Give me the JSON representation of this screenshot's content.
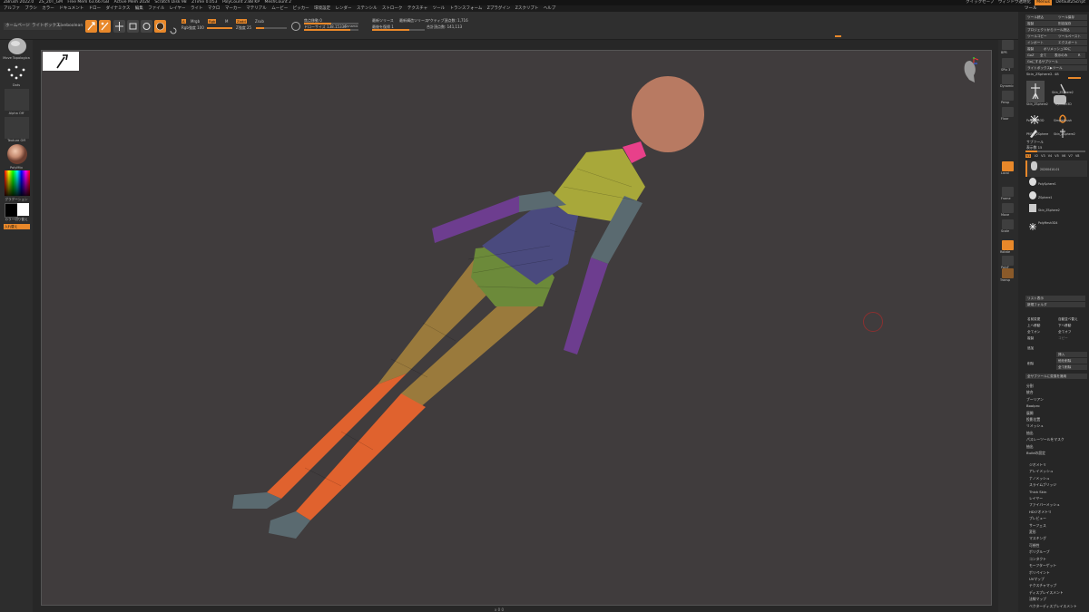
{
  "titlebar": {
    "segments": [
      "ZBrush 2022.0",
      "ZS_20T_GM",
      "Free Mem 63.667GB",
      "Active Mem 2028",
      "Scratch Disk 98",
      "ZTime 0.053",
      "PolyCount 2.88 KP",
      "MeshCount 2"
    ],
    "right_items": [
      "クイックセーブ",
      "ウィンドウ透明化",
      "Menus",
      "DefaultZScript"
    ]
  },
  "menubar": {
    "items": [
      "アルファ",
      "ブラシ",
      "カラー",
      "ドキュメント",
      "ドロー",
      "ダイナミクス",
      "編集",
      "ファイル",
      "レイヤー",
      "ライト",
      "マクロ",
      "マーカー",
      "マテリアル",
      "ムービー",
      "ピッカー",
      "環境設定",
      "レンダー",
      "ステンシル",
      "ストローク",
      "テクスチャ",
      "ツール",
      "トランスフォーム",
      "Zプラグイン",
      "Zスクリプト",
      "ヘルプ"
    ],
    "tool_title": "ツール"
  },
  "shelf": {
    "tabs": [
      "ホームページ",
      "ライトボックス",
      "Liveboolean"
    ],
    "buttons": [
      "edit",
      "draw",
      "move",
      "scale",
      "rotate"
    ],
    "mrgb": "Mrgb",
    "rgb": "Rgb",
    "m": "M",
    "zadd": "Zadd",
    "zsub": "Zsub",
    "rgb_intensity_label": "Rgb強度 100",
    "rgb_intensity": 1.0,
    "z_intensity_label": "Z強度 25",
    "z_intensity": 0.25,
    "focal_shift_label": "焦点移動 0",
    "focal_shift": 0.5,
    "draw_size_label": "ドローサイズ 138.15336",
    "draw_size": 0.85,
    "dynamic": "Dynamic",
    "active_points": "アクティブ頂点数: 1,716",
    "total_points": "合計頂点数: 141,113",
    "symmetry1": "最新ツリース",
    "symmetry2": "最新構造ツリース",
    "history_label": "最後を復帰 1"
  },
  "leftshelf": {
    "brush_name": "Move Topologica",
    "stroke_name": "Dots",
    "alpha_name": "Alpha Off",
    "texture_name": "Texture Off",
    "material_name": "PolyMtx",
    "gradient_label": "グラデーション",
    "switch_color_label": "カラー切り替え",
    "alternate_label": "入れ替え"
  },
  "canvas": {
    "colors": {
      "bg": "#403c3d",
      "head": "#b87a62",
      "yellow": "#a8a83a",
      "purple": "#6d3d8f",
      "navy": "#4a4a7e",
      "green": "#6c8a3a",
      "orange": "#e0622e",
      "brown": "#9a7a3c",
      "grey": "#5a6a70",
      "pink": "#e8408a"
    }
  },
  "rstrip": {
    "labels": [
      "BPR",
      "SPix 3",
      "Dynamic",
      "Persp",
      "Floor",
      "Local",
      "Frame",
      "Move",
      "Scale",
      "Rotate",
      "PolyF",
      "Transp"
    ]
  },
  "rpanel": {
    "top_buttons": [
      [
        "ツール読込",
        "ツール保存"
      ],
      [
        "複製",
        "別名保存"
      ],
      [
        "プロジェクトからツール読込",
        ""
      ],
      [
        "ツールコピー",
        "ツールペースト"
      ],
      [
        "インポート",
        "エクスポート"
      ],
      [
        "複製",
        "ポリメッシュ3Dに"
      ],
      [
        "GoZ",
        "全て",
        "表示のみ",
        "R"
      ],
      [
        "Goにするサブツール",
        ""
      ],
      [
        "ライトボックス▶ツール",
        ""
      ]
    ],
    "current_tool": "Skin_ZSphere2. 48",
    "tool_thumbs": [
      "Skin_ZSphere2",
      "Skin_ZSphere2",
      "Cylinder3D",
      "PolyMesh3D",
      "SimpleBrush",
      "ZSphere",
      "PM3D_ZSphere",
      "Skin_ZSphere2"
    ],
    "subtool_header": "サブツール",
    "visible_count": "表示数 15",
    "subtool_tabs": [
      "V1",
      "V2",
      "V3",
      "V4",
      "V5",
      "V6",
      "V7",
      "V8"
    ],
    "subtools": [
      "20200410-01",
      "PolySphere1",
      "ZSphere1",
      "Skin_ZSphere2",
      "PolyMesh3D4"
    ],
    "mid_buttons": [
      [
        "リスト表示",
        "",
        ""
      ],
      [
        "新規フォルダ",
        "",
        ""
      ],
      [
        "名前変更",
        "自動並べ替え"
      ],
      [
        "上へ移動",
        "下へ移動"
      ],
      [
        "全てオン",
        "全てオフ"
      ],
      [
        "複製",
        "コピー"
      ],
      [
        "追加",
        "挿入"
      ],
      [
        "削除",
        "他を削除"
      ],
      [
        "",
        "全て削除"
      ]
    ],
    "apply_label": "全サブツールに変換を適用",
    "sub_menu": [
      "分割",
      "統合",
      "ブーリアン",
      "Remesh",
      "展開",
      "投影",
      "押出",
      "抽出"
    ],
    "sub_menu2": [
      "ブーリアン",
      "Boolpro",
      "展開",
      "投影位置",
      "リメッシュ",
      "抽出",
      "パスレーツールをマスク",
      "抽出",
      "Buildの設定"
    ],
    "main_menu": [
      "ジオメトリ",
      "アレイメッシュ",
      "ナノメッシュ",
      "スライムブリッジ",
      "Thick Skin",
      "レイヤー",
      "ファイバーメッシュ",
      "HDジオメトリ",
      "プレビュー",
      "サーフェス",
      "変形",
      "マスキング",
      "可視性",
      "ポリグループ",
      "コンタクト",
      "モーフターゲット",
      "ポリペイント",
      "UVマップ",
      "テクスチャマップ",
      "ディスプレイスメント",
      "法線マップ",
      "ベクターディスプレイスメント"
    ]
  },
  "coord": "x 0 0"
}
